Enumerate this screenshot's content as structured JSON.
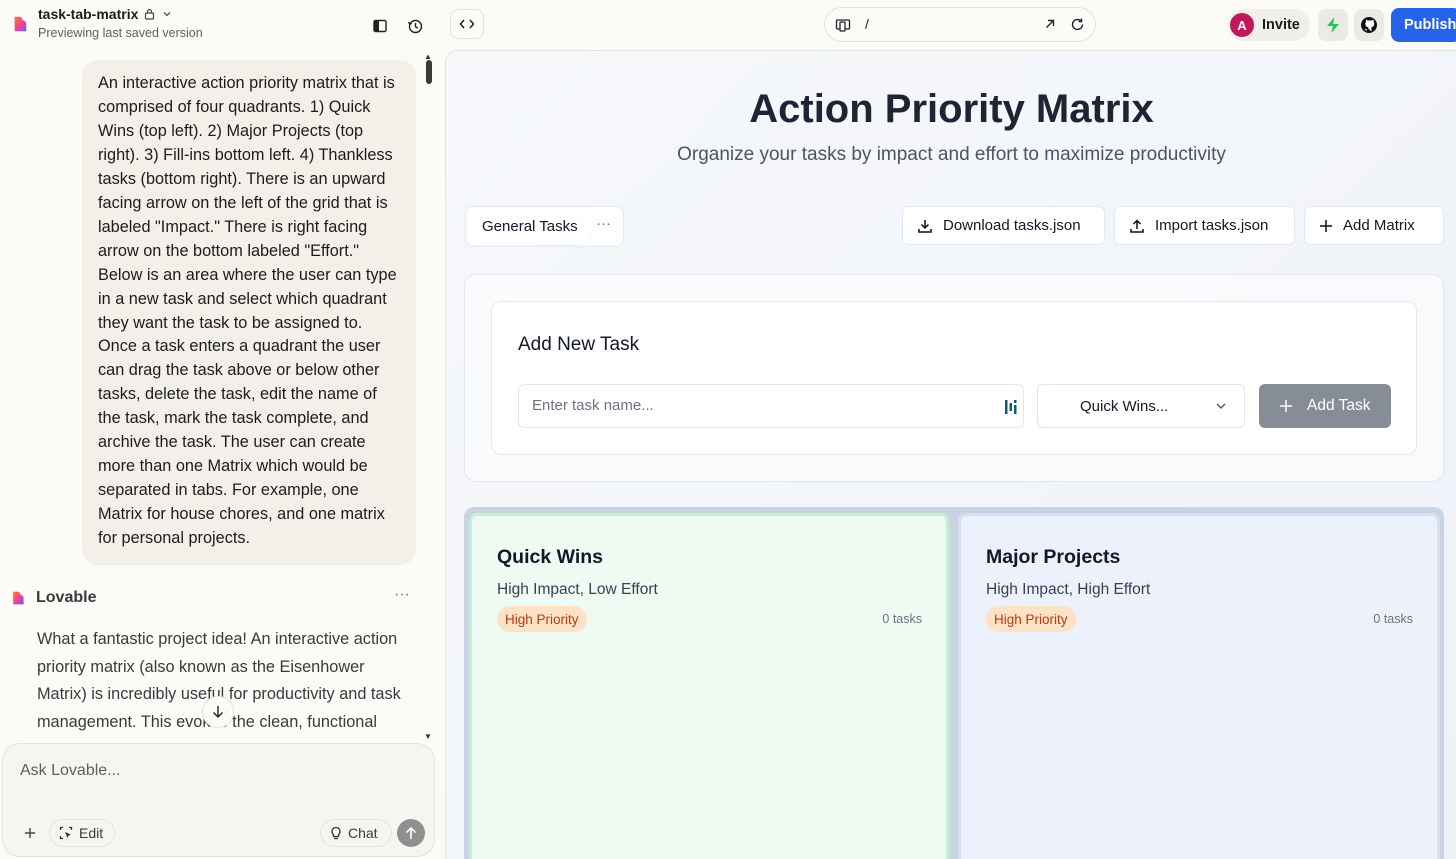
{
  "topbar": {
    "project_name": "task-tab-matrix",
    "project_status": "Previewing last saved version",
    "url_path": "/",
    "avatar_letter": "A",
    "invite_label": "Invite",
    "publish_label": "Publish"
  },
  "chat": {
    "user_message": "An interactive action priority matrix that is comprised of four quadrants. 1) Quick Wins (top left). 2) Major Projects (top right). 3) Fill-ins bottom left. 4) Thankless tasks (bottom right). There is an upward facing arrow on the left of the grid that is labeled \"Impact.\" There is right facing arrow on the bottom labeled \"Effort.\" Below is an area where the user can type in a new task and select which quadrant they want the task to be assigned to. Once a task enters a quadrant the user can drag the task above or below other tasks, delete the task, edit the name of the task, mark the task complete, and archive the task. The user can create more than one Matrix which would be separated in tabs. For example, one Matrix for house chores, and one matrix for personal projects.",
    "assistant_name": "Lovable",
    "assistant_message": "What a fantastic project idea! An interactive action priority matrix (also known as the Eisenhower Matrix) is incredibly useful for productivity and task management. This evokes the clean, functional design of tools like Notion",
    "composer_placeholder": "Ask Lovable...",
    "edit_label": "Edit",
    "chat_label": "Chat",
    "more_label": "···"
  },
  "app": {
    "title": "Action Priority Matrix",
    "subtitle": "Organize your tasks by impact and effort to maximize productivity",
    "tab_label": "General Tasks",
    "tab_more": "···",
    "download_label": "Download tasks.json",
    "import_label": "Import tasks.json",
    "add_matrix_label": "Add Matrix",
    "form_title": "Add New Task",
    "task_placeholder": "Enter task name...",
    "quadrant_selected": "Quick Wins...",
    "add_task_label": "Add Task",
    "quadrants": [
      {
        "title": "Quick Wins",
        "subtitle": "High Impact, Low Effort",
        "badge": "High Priority",
        "count": "0 tasks",
        "color": "#eefbf2"
      },
      {
        "title": "Major Projects",
        "subtitle": "High Impact, High Effort",
        "badge": "High Priority",
        "count": "0 tasks",
        "color": "#edf1fb"
      }
    ]
  },
  "colors": {
    "publish": "#2563eb",
    "avatar": "#c2185b",
    "bolt": "#22c55e",
    "badge_bg": "#fde2c6",
    "badge_text": "#b43c12"
  }
}
